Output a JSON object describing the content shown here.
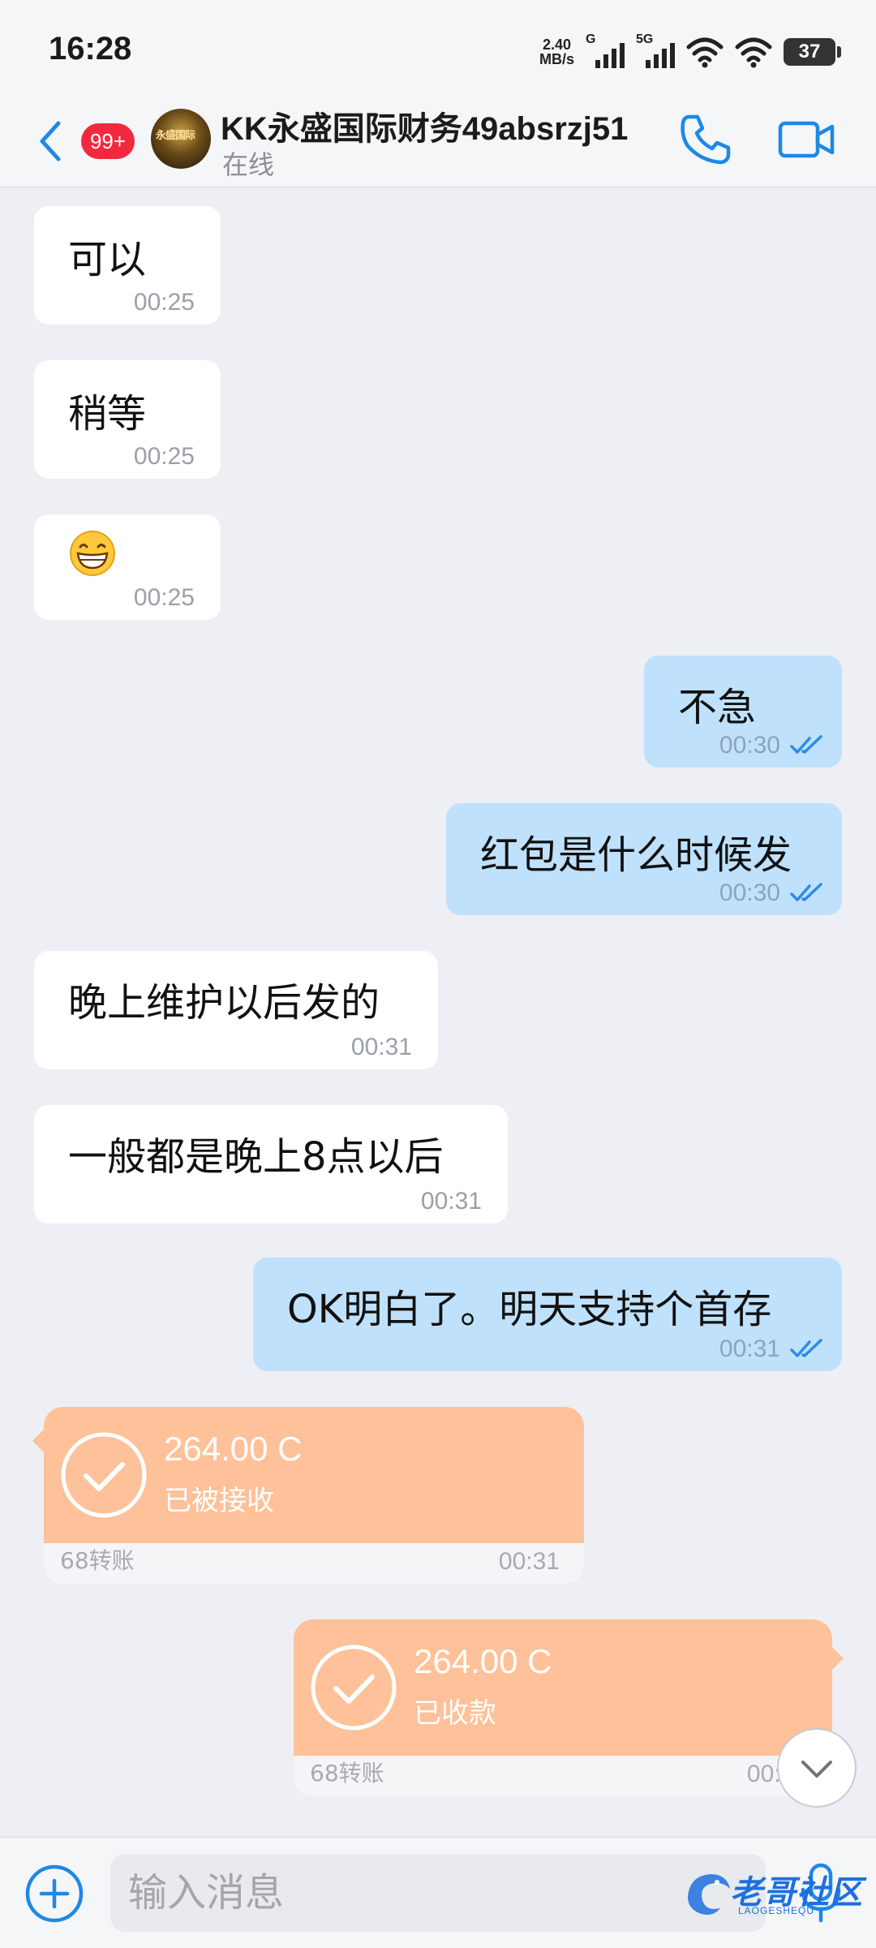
{
  "status_bar": {
    "time": "16:28",
    "net_speed_value": "2.40",
    "net_speed_unit": "MB/s",
    "signal1_label": "G",
    "signal2_label": "5G",
    "battery": "37"
  },
  "header": {
    "unread_count": "99+",
    "contact_name": "KK永盛国际财务49absrzj51",
    "presence": "在线",
    "avatar_text": "永盛国际"
  },
  "messages": [
    {
      "direction": "in",
      "text": "可以",
      "time": "00:25"
    },
    {
      "direction": "in",
      "text": "稍等",
      "time": "00:25"
    },
    {
      "direction": "in",
      "emoji": "grinning-face",
      "time": "00:25"
    },
    {
      "direction": "out",
      "text": "不急",
      "time": "00:30",
      "read": true
    },
    {
      "direction": "out",
      "text": "红包是什么时候发",
      "time": "00:30",
      "read": true
    },
    {
      "direction": "in",
      "text": "晚上维护以后发的",
      "time": "00:31"
    },
    {
      "direction": "in",
      "text": "一般都是晚上8点以后",
      "time": "00:31"
    },
    {
      "direction": "out",
      "text": "OK明白了。明天支持个首存",
      "time": "00:31",
      "read": true
    }
  ],
  "transfers": [
    {
      "direction": "in",
      "amount": "264.00 C",
      "status": "已被接收",
      "label": "68转账",
      "time": "00:31"
    },
    {
      "direction": "out",
      "amount": "264.00 C",
      "status": "已收款",
      "label": "68转账",
      "time": "00:31"
    }
  ],
  "input": {
    "placeholder": "输入消息"
  },
  "watermark": {
    "text": "老哥社区",
    "sub": "LAOGESHEQU"
  },
  "colors": {
    "accent": "#1E88E5",
    "outgoing_bubble": "#BFE1FB",
    "incoming_bubble": "#FFFFFF",
    "transfer_card": "#FEC199",
    "badge": "#F2293E",
    "background": "#EDEFF4"
  },
  "icons": [
    "back-arrow-icon",
    "phone-icon",
    "video-camera-icon",
    "double-check-icon",
    "check-circle-icon",
    "chevron-down-icon",
    "plus-circle-icon",
    "microphone-icon"
  ]
}
